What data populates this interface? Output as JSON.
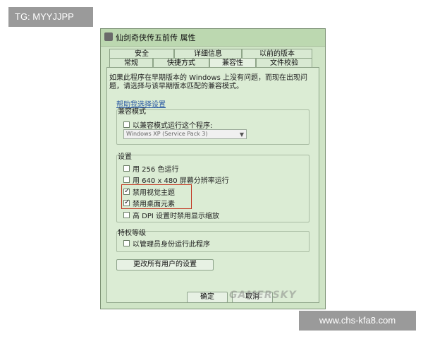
{
  "overlay": {
    "top_tag": "TG: MYYJJPP",
    "bottom_tag": "www.chs-kfa8.com"
  },
  "window": {
    "title": "仙剑奇侠传五前传 属性",
    "tabs_top": [
      "安全",
      "详细信息",
      "以前的版本"
    ],
    "tabs_bottom": [
      "常规",
      "快捷方式",
      "兼容性",
      "文件校验"
    ],
    "active_tab": "兼容性"
  },
  "compat": {
    "description": "如果此程序在早期版本的 Windows 上没有问题，而现在出现问题，请选择与该早期版本匹配的兼容模式。",
    "help_link": "帮助我选择设置",
    "mode_group_title": "兼容模式",
    "mode_checkbox_label": "以兼容模式运行这个程序:",
    "mode_select_value": "Windows XP (Service Pack 3)",
    "settings_group_title": "设置",
    "settings": [
      {
        "label": "用 256 色运行",
        "checked": false
      },
      {
        "label": "用 640 x 480 屏幕分辨率运行",
        "checked": false
      },
      {
        "label": "禁用视觉主题",
        "checked": true
      },
      {
        "label": "禁用桌面元素",
        "checked": true
      },
      {
        "label": "高 DPI 设置时禁用显示缩放",
        "checked": false
      }
    ],
    "privilege_group_title": "特权等级",
    "privilege_checkbox_label": "以管理员身份运行此程序",
    "change_all_users_button": "更改所有用户的设置"
  },
  "buttons": {
    "ok": "确定",
    "cancel": "取消"
  },
  "watermark": "GAMERSKY",
  "colors": {
    "window_bg": "#cfe4c6",
    "highlight_border": "#c2341f",
    "tag_bg": "#9a9a9a"
  }
}
